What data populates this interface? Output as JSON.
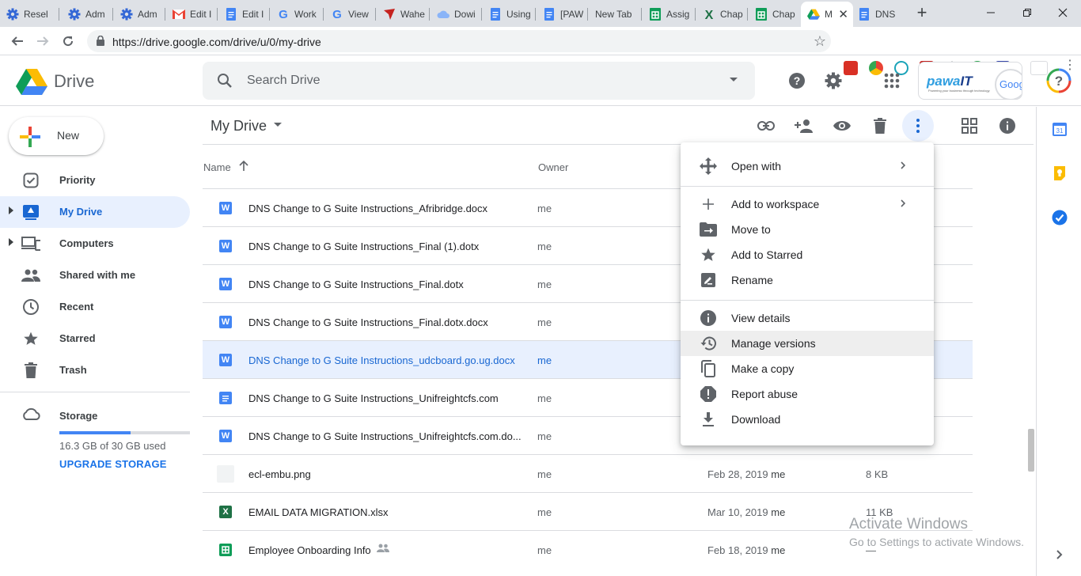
{
  "browser": {
    "tabs": [
      {
        "title": "Resel",
        "icon": "cog-icon",
        "color": "#3367d6"
      },
      {
        "title": "Adm",
        "icon": "cog-icon",
        "color": "#3367d6"
      },
      {
        "title": "Adm",
        "icon": "cog-icon",
        "color": "#3367d6"
      },
      {
        "title": "Edit I",
        "icon": "gmail-icon",
        "color": "#ea4335"
      },
      {
        "title": "Edit I",
        "icon": "docs-icon",
        "color": "#4285f4"
      },
      {
        "title": "Work",
        "icon": "google-icon",
        "color": "#4285f4"
      },
      {
        "title": "View",
        "icon": "google-icon",
        "color": "#4285f4"
      },
      {
        "title": "Wahe",
        "icon": "bird-icon",
        "color": "#c5221f"
      },
      {
        "title": "Dowi",
        "icon": "cloud-icon",
        "color": "#8ab4f8"
      },
      {
        "title": "Using",
        "icon": "docs-icon",
        "color": "#4285f4"
      },
      {
        "title": "[PAW",
        "icon": "docs-icon",
        "color": "#4285f4"
      },
      {
        "title": "New Tab",
        "icon": "",
        "color": ""
      },
      {
        "title": "Assig",
        "icon": "sheets-icon",
        "color": "#0f9d58"
      },
      {
        "title": "Chap",
        "icon": "excel-icon",
        "color": "#1e7145"
      },
      {
        "title": "Chap",
        "icon": "sheets-icon",
        "color": "#0f9d58"
      },
      {
        "title": "M",
        "icon": "drive-icon",
        "color": "#fbbc04"
      },
      {
        "title": "DNS",
        "icon": "docs-icon",
        "color": "#4285f4"
      }
    ],
    "url": "https://drive.google.com/drive/u/0/my-drive"
  },
  "header": {
    "app_name": "Drive",
    "search_placeholder": "Search Drive",
    "brand": {
      "name_a": "pawa",
      "name_b": "IT",
      "tagline": "Powering your business through technology",
      "right": "Goog",
      "right_accent": "l"
    }
  },
  "sidebar": {
    "new_label": "New",
    "items": [
      {
        "label": "Priority",
        "icon": "priority-icon"
      },
      {
        "label": "My Drive",
        "icon": "my-drive-icon"
      },
      {
        "label": "Computers",
        "icon": "computers-icon"
      },
      {
        "label": "Shared with me",
        "icon": "shared-icon"
      },
      {
        "label": "Recent",
        "icon": "clock-icon"
      },
      {
        "label": "Starred",
        "icon": "star-icon"
      },
      {
        "label": "Trash",
        "icon": "trash-icon"
      }
    ],
    "storage_label": "Storage",
    "storage_used_fraction": 0.543,
    "storage_text": "16.3 GB of 30 GB used",
    "upgrade_label": "UPGRADE STORAGE"
  },
  "main": {
    "title": "My Drive",
    "columns": {
      "name": "Name",
      "owner": "Owner"
    },
    "files": [
      {
        "name": "DNS Change to G Suite Instructions_Afribridge.docx",
        "type": "word",
        "owner": "me",
        "modified": "",
        "modified_by": "",
        "size": "",
        "selected": false,
        "shared": false
      },
      {
        "name": "DNS Change to G Suite Instructions_Final (1).dotx",
        "type": "word",
        "owner": "me",
        "modified": "",
        "modified_by": "",
        "size": "",
        "selected": false,
        "shared": false
      },
      {
        "name": "DNS Change to G Suite Instructions_Final.dotx",
        "type": "word",
        "owner": "me",
        "modified": "",
        "modified_by": "",
        "size": "",
        "selected": false,
        "shared": false
      },
      {
        "name": "DNS Change to G Suite Instructions_Final.dotx.docx",
        "type": "word",
        "owner": "me",
        "modified": "",
        "modified_by": "",
        "size": "",
        "selected": false,
        "shared": false
      },
      {
        "name": "DNS Change to G Suite Instructions_udcboard.go.ug.docx",
        "type": "word",
        "owner": "me",
        "modified": "",
        "modified_by": "",
        "size": "",
        "selected": true,
        "shared": false
      },
      {
        "name": "DNS Change to G Suite Instructions_Unifreightcfs.com",
        "type": "doc",
        "owner": "me",
        "modified": "",
        "modified_by": "",
        "size": "",
        "selected": false,
        "shared": false
      },
      {
        "name": "DNS Change to G Suite Instructions_Unifreightcfs.com.do...",
        "type": "word",
        "owner": "me",
        "modified": "",
        "modified_by": "",
        "size": "",
        "selected": false,
        "shared": false
      },
      {
        "name": "ecl-embu.png",
        "type": "image",
        "owner": "me",
        "modified": "Feb 28, 2019",
        "modified_by": "me",
        "size": "8 KB",
        "selected": false,
        "shared": false
      },
      {
        "name": "EMAIL DATA MIGRATION.xlsx",
        "type": "excel",
        "owner": "me",
        "modified": "Mar 10, 2019",
        "modified_by": "me",
        "size": "11 KB",
        "selected": false,
        "shared": false
      },
      {
        "name": "Employee Onboarding Info",
        "type": "sheet",
        "owner": "me",
        "modified": "Feb 18, 2019",
        "modified_by": "me",
        "size": "—",
        "selected": false,
        "shared": true
      }
    ]
  },
  "context_menu": {
    "items": [
      {
        "label": "Open with",
        "icon": "open-with-icon",
        "submenu": true
      },
      {
        "label": "Add to workspace",
        "icon": "plus-icon",
        "submenu": true
      },
      {
        "label": "Move to",
        "icon": "move-to-icon",
        "submenu": false
      },
      {
        "label": "Add to Starred",
        "icon": "star-icon",
        "submenu": false
      },
      {
        "label": "Rename",
        "icon": "rename-icon",
        "submenu": false
      },
      {
        "label": "View details",
        "icon": "info-icon",
        "submenu": false
      },
      {
        "label": "Manage versions",
        "icon": "history-icon",
        "submenu": false,
        "highlighted": true
      },
      {
        "label": "Make a copy",
        "icon": "copy-icon",
        "submenu": false
      },
      {
        "label": "Report abuse",
        "icon": "report-icon",
        "submenu": false
      },
      {
        "label": "Download",
        "icon": "download-icon",
        "submenu": false
      }
    ]
  },
  "side_panel": {
    "calendar_day": "31"
  },
  "watermark": {
    "line1": "Activate Windows",
    "line2": "Go to Settings to activate Windows."
  },
  "colors": {
    "accent": "#1a73e8",
    "selected_bg": "#e8f0fe",
    "word": "#4285f4",
    "sheets": "#0f9d58",
    "excel": "#1e7145"
  }
}
